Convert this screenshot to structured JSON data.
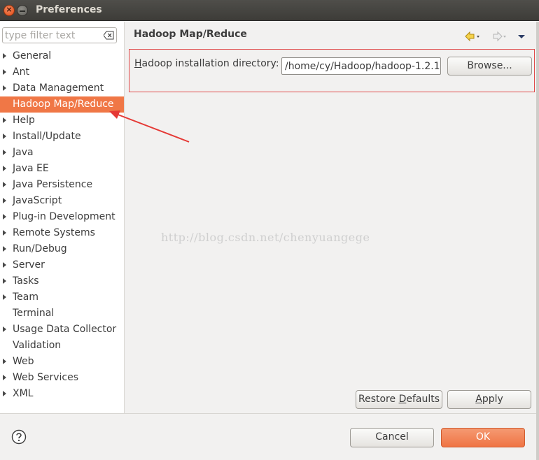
{
  "window": {
    "title": "Preferences"
  },
  "filter": {
    "placeholder": "type filter text"
  },
  "tree": [
    {
      "label": "General",
      "expandable": true
    },
    {
      "label": "Ant",
      "expandable": true
    },
    {
      "label": "Data Management",
      "expandable": true
    },
    {
      "label": "Hadoop Map/Reduce",
      "expandable": false,
      "selected": true
    },
    {
      "label": "Help",
      "expandable": true
    },
    {
      "label": "Install/Update",
      "expandable": true
    },
    {
      "label": "Java",
      "expandable": true
    },
    {
      "label": "Java EE",
      "expandable": true
    },
    {
      "label": "Java Persistence",
      "expandable": true
    },
    {
      "label": "JavaScript",
      "expandable": true
    },
    {
      "label": "Plug-in Development",
      "expandable": true
    },
    {
      "label": "Remote Systems",
      "expandable": true
    },
    {
      "label": "Run/Debug",
      "expandable": true
    },
    {
      "label": "Server",
      "expandable": true
    },
    {
      "label": "Tasks",
      "expandable": true
    },
    {
      "label": "Team",
      "expandable": true
    },
    {
      "label": "Terminal",
      "expandable": false
    },
    {
      "label": "Usage Data Collector",
      "expandable": true
    },
    {
      "label": "Validation",
      "expandable": false
    },
    {
      "label": "Web",
      "expandable": true
    },
    {
      "label": "Web Services",
      "expandable": true
    },
    {
      "label": "XML",
      "expandable": true
    }
  ],
  "page": {
    "title": "Hadoop Map/Reduce",
    "field_label_mnemonic": "H",
    "field_label_rest": "adoop installation directory:",
    "field_value": "/home/cy/Hadoop/hadoop-1.2.1",
    "browse_label": "Browse..."
  },
  "watermark": "http://blog.csdn.net/chenyuangege",
  "buttons": {
    "restore_defaults_pre": "Restore ",
    "restore_defaults_mnemonic": "D",
    "restore_defaults_post": "efaults",
    "apply_mnemonic": "A",
    "apply_rest": "pply",
    "cancel": "Cancel",
    "ok": "OK"
  },
  "colors": {
    "selection": "#f07746",
    "ok_button": "#ef7444",
    "annotation": "#e53935",
    "title_bar": "#3d3c38"
  },
  "icons": [
    "close-icon",
    "minimize-icon",
    "clear-filter-icon",
    "back-arrow-icon",
    "forward-arrow-icon",
    "view-menu-icon",
    "help-icon"
  ]
}
